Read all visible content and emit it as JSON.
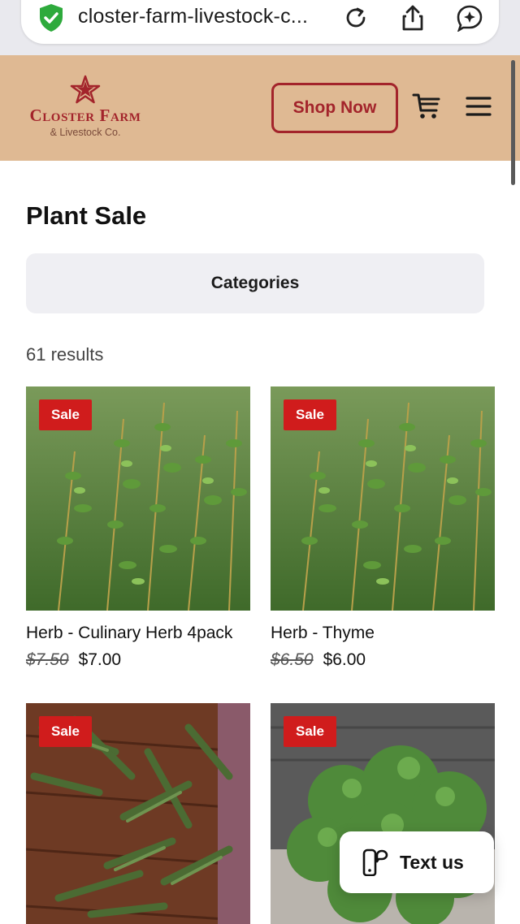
{
  "browser": {
    "url": "closter-farm-livestock-c...",
    "icons": [
      "shield-check-icon",
      "reload-icon",
      "share-icon",
      "assistant-icon"
    ]
  },
  "header": {
    "logo_name": "Closter Farm",
    "logo_sub": "& Livestock Co.",
    "shop_button": "Shop Now",
    "icons": [
      "cart-icon",
      "menu-icon"
    ],
    "brand_color": "#a3242b",
    "header_bg": "#dfb993"
  },
  "main": {
    "title": "Plant Sale",
    "categories_label": "Categories",
    "results_count": "61 results"
  },
  "products": [
    {
      "badge": "Sale",
      "name": "Herb - Culinary Herb 4pack",
      "old_price": "$7.50",
      "price": "$7.00",
      "image": "thyme-photo"
    },
    {
      "badge": "Sale",
      "name": "Herb - Thyme",
      "old_price": "$6.50",
      "price": "$6.00",
      "image": "thyme-photo"
    },
    {
      "badge": "Sale",
      "name": "",
      "old_price": "",
      "price": "",
      "image": "tarragon-photo"
    },
    {
      "badge": "Sale",
      "name": "",
      "old_price": "",
      "price": "",
      "image": "oregano-photo"
    }
  ],
  "widget": {
    "text_us_label": "Text us",
    "icon": "chat-phone-icon"
  },
  "colors": {
    "sale_badge": "#d01c1c"
  }
}
